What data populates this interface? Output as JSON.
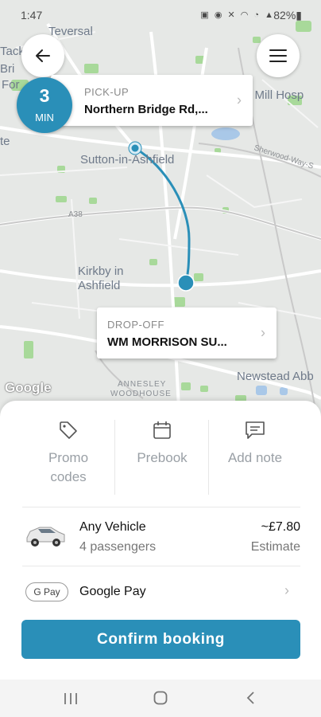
{
  "status_bar": {
    "time": "1:47",
    "icons": "▣ ◉ ✕ ◠ ◔ ▲",
    "battery": "82%▮"
  },
  "map": {
    "labels": {
      "teversal": "Teversal",
      "tack": "Tack",
      "bri": "Bri",
      "for": "For",
      "te": "te",
      "mill_hosp": "'s Mill Hosp",
      "sutton": "Sutton-in-Ashfield",
      "kirkby_line1": "Kirkby in",
      "kirkby_line2": "Ashfield",
      "a38": "A38",
      "sherwood_way": "Sherwood-Way-S",
      "newstead": "Newstead Abb",
      "annesley_line1": "ANNESLEY",
      "annesley_line2": "WOODHOUSE",
      "google": "Google"
    }
  },
  "eta": {
    "value": "3",
    "unit": "MIN"
  },
  "pickup": {
    "caption": "PICK-UP",
    "address": "Northern Bridge Rd,..."
  },
  "dropoff": {
    "caption": "DROP-OFF",
    "address": "WM MORRISON SU..."
  },
  "options": {
    "promo_line1": "Promo",
    "promo_line2": "codes",
    "prebook": "Prebook",
    "add_note": "Add note"
  },
  "vehicle": {
    "name": "Any Vehicle",
    "passengers": "4 passengers",
    "price": "~£7.80",
    "price_note": "Estimate"
  },
  "payment": {
    "badge": "G Pay",
    "method": "Google Pay"
  },
  "confirm_label": "Confirm booking",
  "colors": {
    "accent": "#2a8fb8"
  }
}
